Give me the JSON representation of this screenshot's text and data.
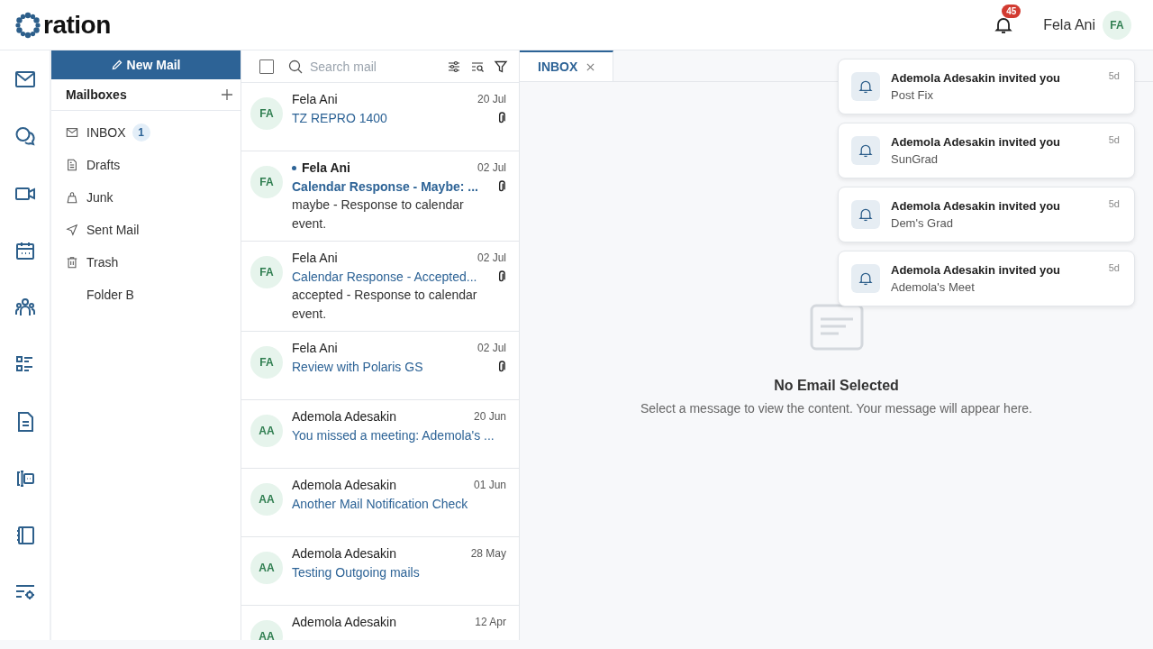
{
  "header": {
    "logo": "ration",
    "notifications_count": "45",
    "user_name": "Fela Ani",
    "user_initials": "FA"
  },
  "rail": [
    {
      "kind": "mail"
    },
    {
      "kind": "chat"
    },
    {
      "kind": "video"
    },
    {
      "kind": "calendar"
    },
    {
      "kind": "people"
    },
    {
      "kind": "tasks"
    },
    {
      "kind": "document"
    },
    {
      "kind": "bot"
    },
    {
      "kind": "notebook"
    },
    {
      "kind": "settings"
    }
  ],
  "sidebar": {
    "new_mail": "New Mail",
    "heading": "Mailboxes",
    "folders": [
      {
        "kind": "inbox",
        "label": "INBOX",
        "count": "1"
      },
      {
        "kind": "drafts",
        "label": "Drafts"
      },
      {
        "kind": "junk",
        "label": "Junk"
      },
      {
        "kind": "sent",
        "label": "Sent Mail"
      },
      {
        "kind": "trash",
        "label": "Trash"
      },
      {
        "kind": "folder",
        "label": "Folder B"
      }
    ]
  },
  "mail_list": {
    "select_all_checked": false,
    "search": {
      "placeholder": "Search mail"
    },
    "messages": [
      {
        "initials": "FA",
        "sender": "Fela Ani",
        "date": "20 Jul",
        "subject": "TZ REPRO 1400",
        "attachment": true,
        "unread": false
      },
      {
        "initials": "FA",
        "sender": "Fela Ani",
        "date": "02 Jul",
        "subject": "Calendar Response - Maybe: ...",
        "preview": "maybe - Response to calendar event.",
        "attachment": true,
        "unread": true
      },
      {
        "initials": "FA",
        "sender": "Fela Ani",
        "date": "02 Jul",
        "subject": "Calendar Response - Accepted...",
        "preview": "accepted - Response to calendar event.",
        "attachment": true,
        "unread": false
      },
      {
        "initials": "FA",
        "sender": "Fela Ani",
        "date": "02 Jul",
        "subject": "Review with Polaris GS",
        "attachment": true,
        "unread": false
      },
      {
        "initials": "AA",
        "sender": "Ademola Adesakin",
        "date": "20 Jun",
        "subject": "You missed a meeting: Ademola's ...",
        "attachment": false,
        "unread": false
      },
      {
        "initials": "AA",
        "sender": "Ademola Adesakin",
        "date": "01 Jun",
        "subject": "Another Mail Notification Check",
        "attachment": false,
        "unread": false
      },
      {
        "initials": "AA",
        "sender": "Ademola Adesakin",
        "date": "28 May",
        "subject": "Testing Outgoing mails",
        "attachment": false,
        "unread": false
      },
      {
        "initials": "AA",
        "sender": "Ademola Adesakin",
        "date": "12 Apr",
        "unread": false
      }
    ]
  },
  "tabs": [
    {
      "label": "INBOX",
      "selected": true
    }
  ],
  "empty_state": {
    "title": "No Email Selected",
    "message": "Select a message to view the content. Your message will appear here."
  },
  "notifications": [
    {
      "title": "Ademola Adesakin invited you",
      "subtitle": "Post Fix",
      "time": "5d"
    },
    {
      "title": "Ademola Adesakin invited you",
      "subtitle": "SunGrad",
      "time": "5d"
    },
    {
      "title": "Ademola Adesakin invited you",
      "subtitle": "Dem's Grad",
      "time": "5d"
    },
    {
      "title": "Ademola Adesakin invited you",
      "subtitle": "Ademola's Meet",
      "time": "5d"
    }
  ]
}
